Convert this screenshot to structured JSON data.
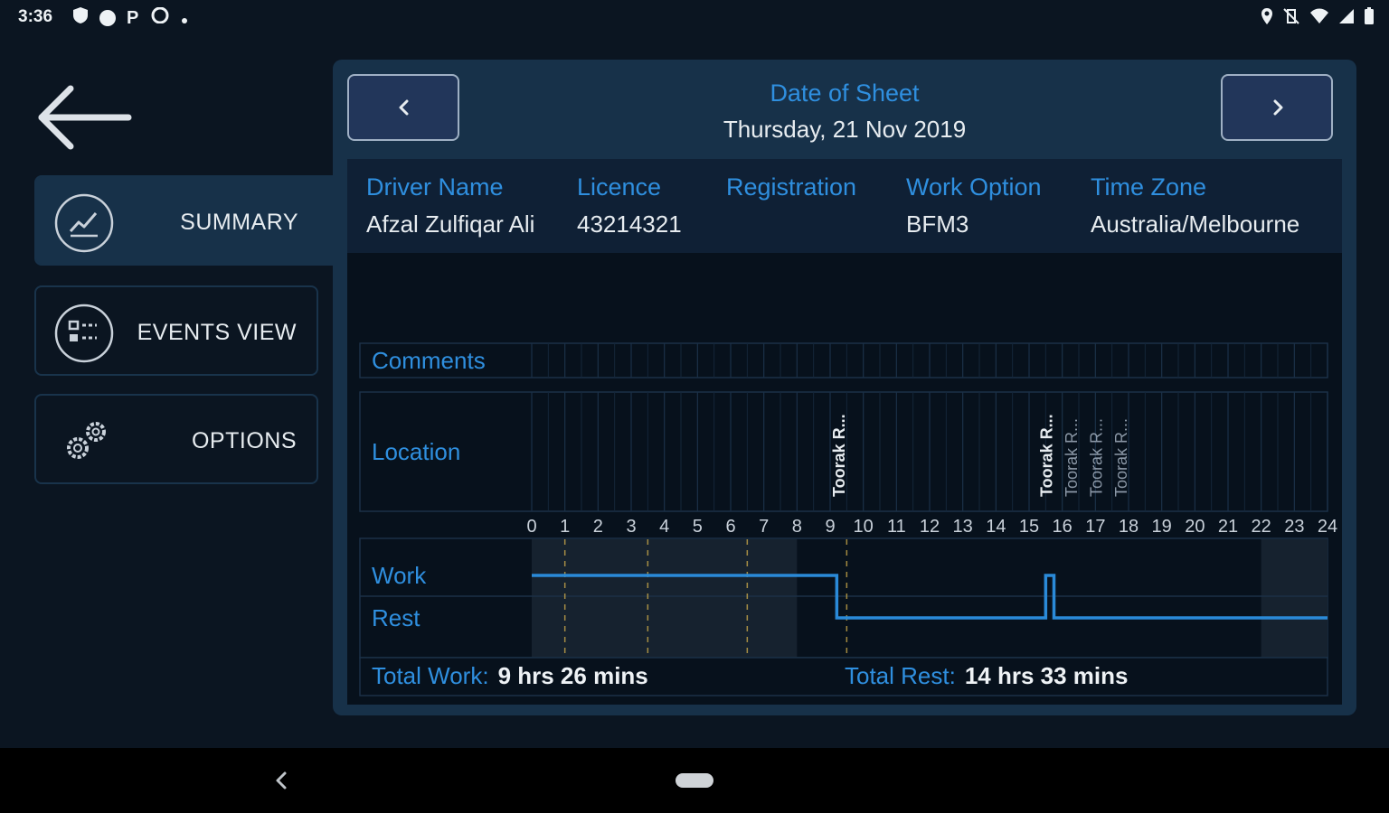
{
  "status_bar": {
    "time": "3:36",
    "left_icons": [
      "shield-icon",
      "circle-icon",
      "p-icon",
      "cloud-icon",
      "dot-icon"
    ],
    "right_icons": [
      "location-icon",
      "vibrate-off-icon",
      "wifi-icon",
      "signal-icon",
      "battery-icon"
    ],
    "p_glyph": "P"
  },
  "sidebar": {
    "items": [
      {
        "label": "SUMMARY",
        "icon": "chart-trend-icon",
        "active": true
      },
      {
        "label": "EVENTS VIEW",
        "icon": "list-icon",
        "active": false
      },
      {
        "label": "OPTIONS",
        "icon": "gears-icon",
        "active": false
      }
    ]
  },
  "header": {
    "title": "Date of Sheet",
    "date": "Thursday, 21 Nov 2019",
    "prev_icon": "chevron-left-icon",
    "next_icon": "chevron-right-icon"
  },
  "info": {
    "driver_name_label": "Driver Name",
    "driver_name": "Afzal Zulfiqar Ali",
    "licence_label": "Licence",
    "licence": "43214321",
    "registration_label": "Registration",
    "registration": "",
    "work_option_label": "Work Option",
    "work_option": "BFM3",
    "time_zone_label": "Time Zone",
    "time_zone": "Australia/Melbourne"
  },
  "chart_data": {
    "type": "line",
    "row_labels": {
      "comments": "Comments",
      "location": "Location",
      "work": "Work",
      "rest": "Rest"
    },
    "hours": [
      0,
      1,
      2,
      3,
      4,
      5,
      6,
      7,
      8,
      9,
      10,
      11,
      12,
      13,
      14,
      15,
      16,
      17,
      18,
      19,
      20,
      21,
      22,
      23,
      24
    ],
    "location_labels": [
      {
        "hour": 9.25,
        "text": "Toorak R...",
        "primary": true
      },
      {
        "hour": 15.5,
        "text": "Toorak R...",
        "primary": true
      },
      {
        "hour": 16.25,
        "text": "Toorak R...",
        "primary": false
      },
      {
        "hour": 17.0,
        "text": "Toorak R...",
        "primary": false
      },
      {
        "hour": 17.75,
        "text": "Toorak R...",
        "primary": false
      }
    ],
    "series": [
      {
        "states": [
          {
            "from": 0,
            "to": 9.2,
            "state": "Work"
          },
          {
            "from": 9.2,
            "to": 15.5,
            "state": "Rest"
          },
          {
            "from": 15.5,
            "to": 15.75,
            "state": "Work"
          },
          {
            "from": 15.75,
            "to": 24,
            "state": "Rest"
          }
        ]
      }
    ],
    "dashed_markers": [
      1,
      3.5,
      6.5,
      9.5
    ],
    "shaded_ranges": [
      [
        0,
        8
      ],
      [
        22,
        24
      ]
    ]
  },
  "totals": {
    "work_label": "Total Work:",
    "work_value": "9 hrs 26 mins",
    "rest_label": "Total Rest:",
    "rest_value": "14 hrs 33 mins"
  },
  "colors": {
    "accent": "#2f8fdf",
    "panel": "#173149",
    "background": "#0b1521",
    "line": "#2a8ad8"
  }
}
